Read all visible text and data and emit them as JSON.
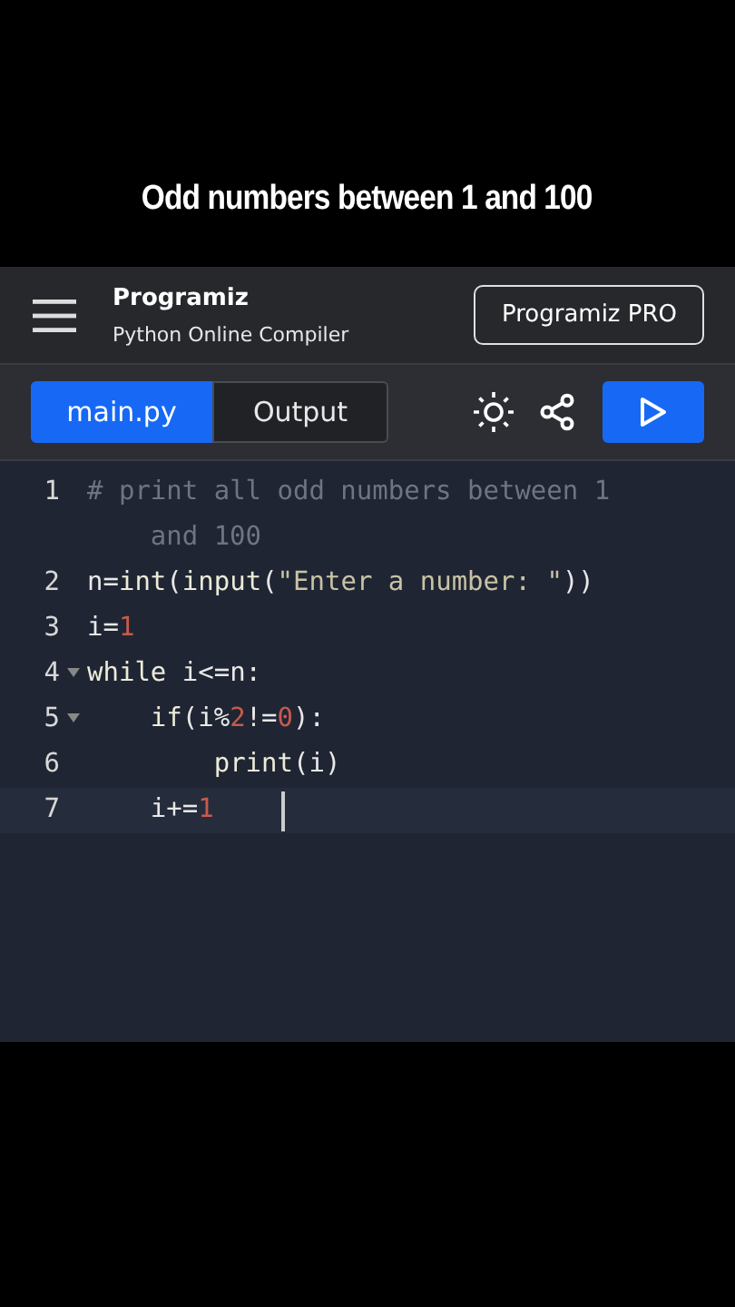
{
  "caption": "Odd numbers between 1 and 100",
  "header": {
    "logo": "Programiz",
    "subtitle": "Python Online Compiler",
    "pro_button": "Programiz PRO"
  },
  "tabs": [
    {
      "label": "main.py",
      "selected": true
    },
    {
      "label": "Output",
      "selected": false
    }
  ],
  "editor": {
    "lines": [
      {
        "number": "1",
        "foldable": false,
        "active": false,
        "tokens": [
          {
            "text": "# print all odd numbers between 1 and 100",
            "kind": "comment"
          }
        ]
      },
      {
        "number": "2",
        "foldable": false,
        "active": false,
        "tokens": [
          {
            "text": "n=",
            "kind": "plain"
          },
          {
            "text": "int",
            "kind": "builtin"
          },
          {
            "text": "(",
            "kind": "plain"
          },
          {
            "text": "input",
            "kind": "builtin"
          },
          {
            "text": "(",
            "kind": "plain"
          },
          {
            "text": "\"Enter a number: \"",
            "kind": "string"
          },
          {
            "text": "))",
            "kind": "plain"
          }
        ]
      },
      {
        "number": "3",
        "foldable": false,
        "active": false,
        "tokens": [
          {
            "text": "i=",
            "kind": "plain"
          },
          {
            "text": "1",
            "kind": "number"
          }
        ]
      },
      {
        "number": "4",
        "foldable": true,
        "active": false,
        "tokens": [
          {
            "text": "while",
            "kind": "builtin"
          },
          {
            "text": " i<=n:",
            "kind": "plain"
          }
        ]
      },
      {
        "number": "5",
        "foldable": true,
        "active": false,
        "tokens": [
          {
            "text": "    if",
            "kind": "builtin"
          },
          {
            "text": "(i%",
            "kind": "plain"
          },
          {
            "text": "2",
            "kind": "number"
          },
          {
            "text": "!=",
            "kind": "plain"
          },
          {
            "text": "0",
            "kind": "number"
          },
          {
            "text": "):",
            "kind": "plain"
          }
        ]
      },
      {
        "number": "6",
        "foldable": false,
        "active": false,
        "tokens": [
          {
            "text": "        print",
            "kind": "builtin"
          },
          {
            "text": "(i)",
            "kind": "plain"
          }
        ]
      },
      {
        "number": "7",
        "foldable": false,
        "active": true,
        "tokens": [
          {
            "text": "    i+=",
            "kind": "plain"
          },
          {
            "text": "1",
            "kind": "number"
          }
        ]
      }
    ]
  }
}
